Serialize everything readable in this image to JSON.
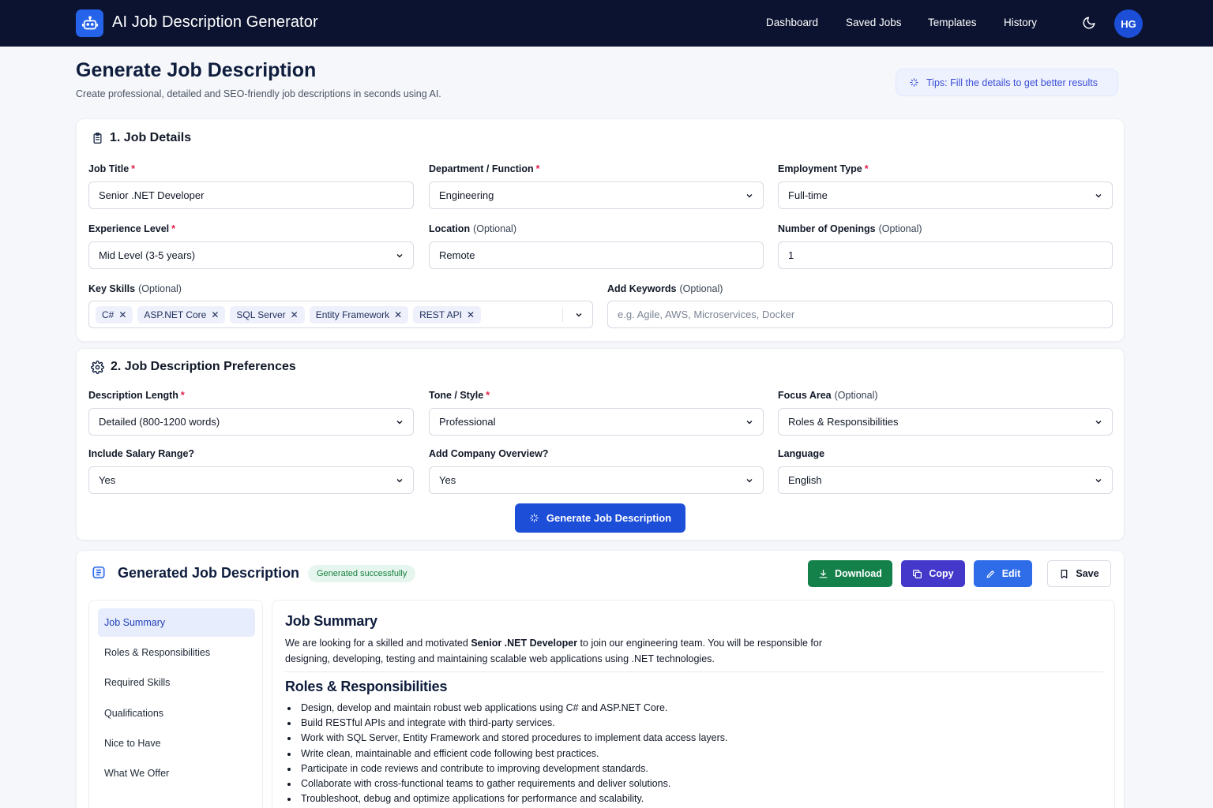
{
  "app": {
    "title": "AI Job Description Generator",
    "logo_icon": "robot-icon"
  },
  "nav": {
    "links": [
      "Dashboard",
      "Saved Jobs",
      "Templates",
      "History"
    ],
    "theme_icon": "moon-icon",
    "avatar_initials": "HG"
  },
  "header": {
    "title": "Generate Job Description",
    "subtitle": "Create professional, detailed and SEO-friendly job descriptions in seconds using AI.",
    "tips": "Tips: Fill the details to get better results"
  },
  "job_details": {
    "heading": "1. Job Details",
    "job_title": {
      "label": "Job Title",
      "value": "Senior .NET Developer"
    },
    "department": {
      "label": "Department / Function",
      "value": "Engineering"
    },
    "employment_type": {
      "label": "Employment Type",
      "value": "Full-time"
    },
    "experience": {
      "label": "Experience Level",
      "value": "Mid Level (3-5 years)"
    },
    "location": {
      "label": "Location",
      "optional": "(Optional)",
      "value": "Remote"
    },
    "openings": {
      "label": "Number of Openings",
      "optional": "(Optional)",
      "value": "1"
    },
    "key_skills": {
      "label": "Key Skills",
      "optional": "(Optional)",
      "tags": [
        "C#",
        "ASP.NET Core",
        "SQL Server",
        "Entity Framework",
        "REST API"
      ]
    },
    "keywords": {
      "label": "Add Keywords",
      "optional": "(Optional)",
      "placeholder": "e.g. Agile, AWS, Microservices, Docker"
    }
  },
  "preferences": {
    "heading": "2. Job Description Preferences",
    "length": {
      "label": "Description Length",
      "value": "Detailed (800-1200 words)"
    },
    "tone": {
      "label": "Tone / Style",
      "value": "Professional"
    },
    "focus": {
      "label": "Focus Area",
      "optional": "(Optional)",
      "value": "Roles & Responsibilities"
    },
    "salary": {
      "label": "Include Salary Range?",
      "value": "Yes"
    },
    "company": {
      "label": "Add Company Overview?",
      "value": "Yes"
    },
    "language": {
      "label": "Language",
      "value": "English"
    },
    "generate_label": "Generate Job Description"
  },
  "output": {
    "title": "Generated Job Description",
    "status": "Generated successfully",
    "actions": {
      "download": "Download",
      "copy": "Copy",
      "edit": "Edit",
      "save": "Save"
    },
    "sections": [
      "Job Summary",
      "Roles & Responsibilities",
      "Required Skills",
      "Qualifications",
      "Nice to Have",
      "What We Offer"
    ],
    "active_section": "Job Summary",
    "summary_heading": "Job Summary",
    "summary_pre": "We are looking for a skilled and motivated ",
    "summary_bold": "Senior .NET Developer",
    "summary_post": " to join our engineering team. You will be responsible for designing, developing, testing and maintaining scalable web applications using .NET technologies.",
    "roles_heading": "Roles & Responsibilities",
    "roles": [
      "Design, develop and maintain robust web applications using C# and ASP.NET Core.",
      "Build RESTful APIs and integrate with third-party services.",
      "Work with SQL Server, Entity Framework and stored procedures to implement data access layers.",
      "Write clean, maintainable and efficient code following best practices.",
      "Participate in code reviews and contribute to improving development standards.",
      "Collaborate with cross-functional teams to gather requirements and deliver solutions.",
      "Troubleshoot, debug and optimize applications for performance and scalability."
    ]
  },
  "colors": {
    "nav_bg": "#0b1330",
    "primary": "#1d4ed8",
    "download": "#14804a",
    "copy": "#4338ca",
    "edit": "#2f6de8",
    "success_text": "#15803d"
  }
}
